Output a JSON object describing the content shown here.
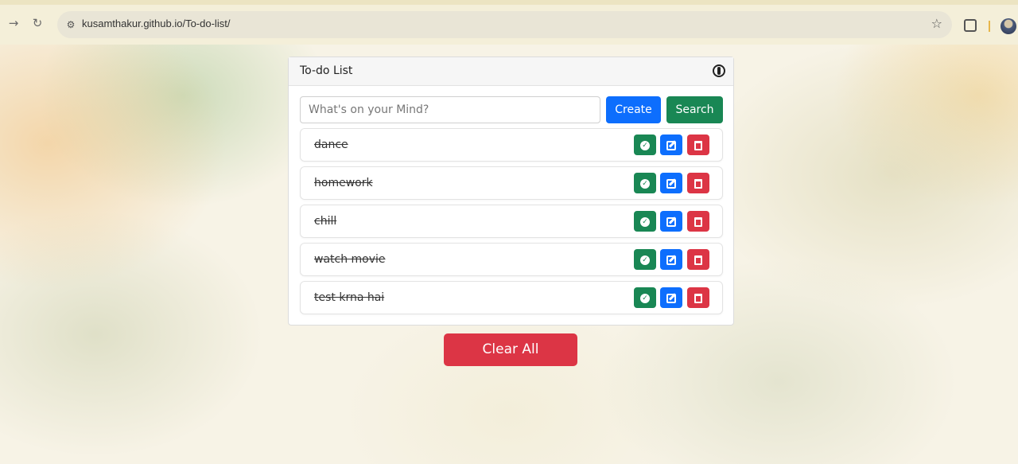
{
  "browser": {
    "url": "kusamthakur.github.io/To-do-list/",
    "icons": [
      "back-arrow-icon",
      "reload-icon",
      "site-info-icon",
      "bookmark-star-icon",
      "extensions-icon",
      "profile-avatar"
    ]
  },
  "card": {
    "title": "To-do List"
  },
  "form": {
    "placeholder": "What's on your Mind?",
    "create_label": "Create",
    "search_label": "Search"
  },
  "todos": [
    {
      "text": "dance",
      "completed": true
    },
    {
      "text": "homework",
      "completed": true
    },
    {
      "text": "chill",
      "completed": true
    },
    {
      "text": "watch movie",
      "completed": true
    },
    {
      "text": "test krna hai",
      "completed": true
    }
  ],
  "clear_all_label": "Clear All",
  "colors": {
    "primary": "#0d6efd",
    "success": "#198754",
    "danger": "#dc3545"
  }
}
